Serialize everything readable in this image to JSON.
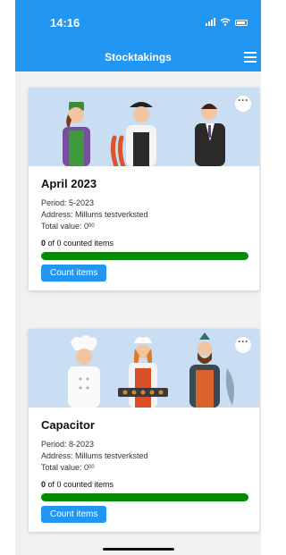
{
  "status": {
    "time": "14:16",
    "icons": [
      "signal-icon",
      "wifi-icon",
      "battery-icon"
    ]
  },
  "header": {
    "title": "Stocktakings",
    "menu_icon": "hamburger-menu-icon"
  },
  "colors": {
    "accent": "#2196f3",
    "progress": "#058b05",
    "banner": "#c9def2"
  },
  "stocktakings": [
    {
      "name": "April 2023",
      "period": "Period: 5-2023",
      "address": "Address: Millums testverksted",
      "value_label": "Total value: 0",
      "value_decimals": "00",
      "counted": "0",
      "counted_suffix": " of 0 counted items",
      "progress": 1.0,
      "button": "Count items",
      "more": "···"
    },
    {
      "name": "Capacitor",
      "period": "Period: 8-2023",
      "address": "Address: Millums testverksted",
      "value_label": "Total value: 0",
      "value_decimals": "00",
      "counted": "0",
      "counted_suffix": " of 0 counted items",
      "progress": 1.0,
      "button": "Count items",
      "more": "···"
    }
  ]
}
